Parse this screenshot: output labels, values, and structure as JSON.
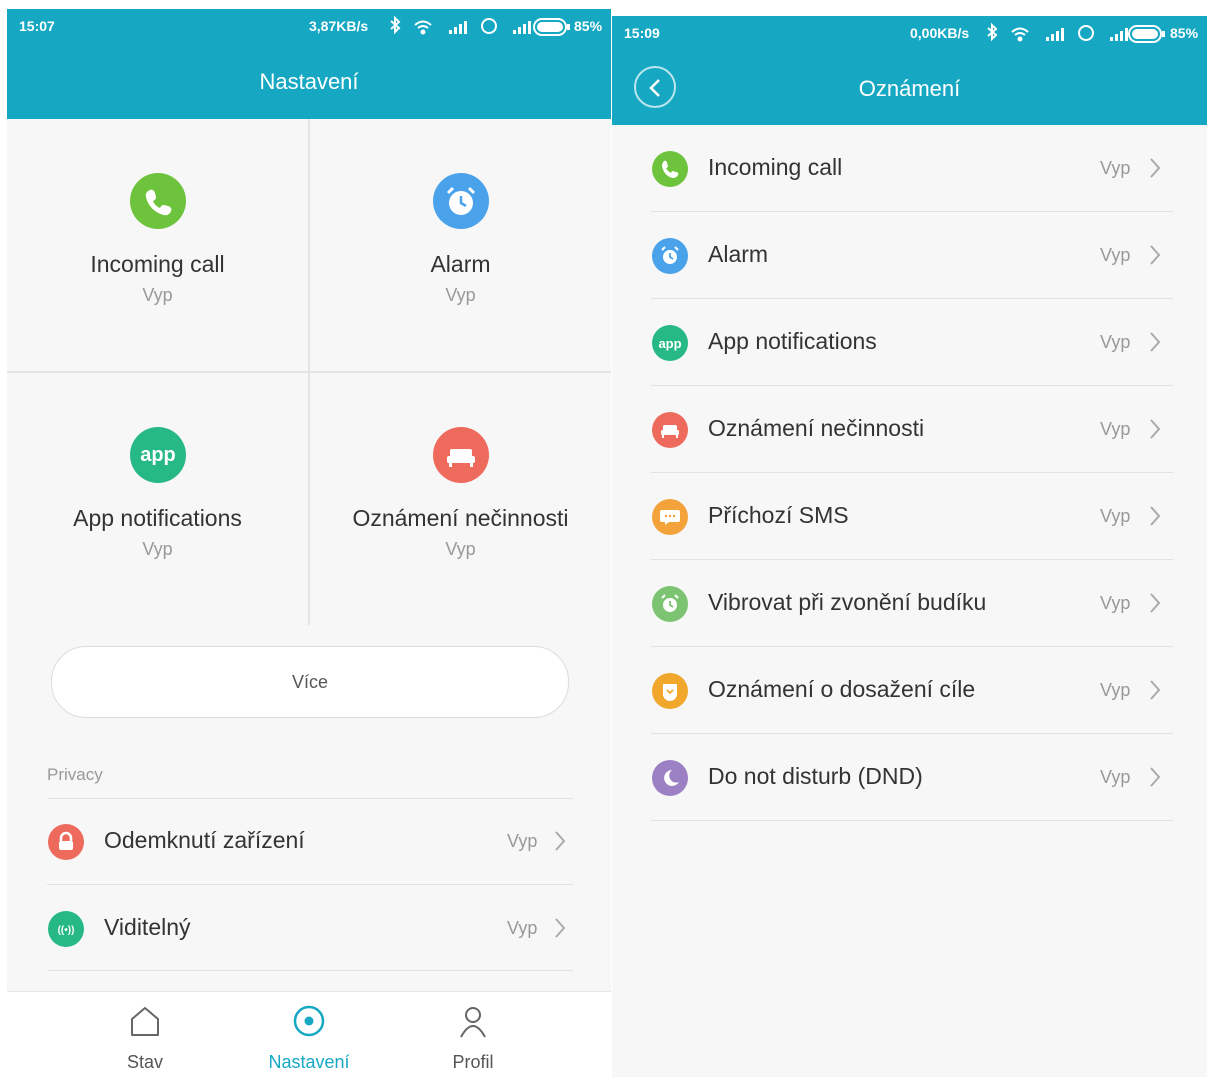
{
  "colors": {
    "accent": "#16a8c3",
    "green": "#6ec33c",
    "blue": "#4aa2ea",
    "teal": "#26b985",
    "red": "#ee6a5c",
    "orange": "#f4a23a",
    "lightgreen": "#7cc472",
    "amber": "#f1a62c",
    "purple": "#9b80c4"
  },
  "left": {
    "status": {
      "time": "15:07",
      "speed": "3,87KB/s",
      "battery": "85%"
    },
    "title": "Nastavení",
    "tiles": [
      {
        "label": "Incoming call",
        "value": "Vyp",
        "icon": "phone-icon"
      },
      {
        "label": "Alarm",
        "value": "Vyp",
        "icon": "alarm-clock-icon"
      },
      {
        "label": "App notifications",
        "value": "Vyp",
        "icon": "app-icon",
        "icon_text": "app"
      },
      {
        "label": "Oznámení nečinnosti",
        "value": "Vyp",
        "icon": "sofa-icon"
      }
    ],
    "more_button": "Více",
    "privacy_label": "Privacy",
    "privacy_rows": [
      {
        "label": "Odemknutí zařízení",
        "value": "Vyp",
        "icon": "lock-icon"
      },
      {
        "label": "Viditelný",
        "value": "Vyp",
        "icon": "broadcast-icon",
        "icon_text": "((•))"
      }
    ],
    "tabs": [
      {
        "label": "Stav",
        "icon": "home-icon"
      },
      {
        "label": "Nastavení",
        "icon": "settings-circle-icon",
        "active": true
      },
      {
        "label": "Profil",
        "icon": "person-icon"
      }
    ]
  },
  "right": {
    "status": {
      "time": "15:09",
      "speed": "0,00KB/s",
      "battery": "85%"
    },
    "title": "Oznámení",
    "rows": [
      {
        "label": "Incoming call",
        "value": "Vyp",
        "icon": "phone-icon"
      },
      {
        "label": "Alarm",
        "value": "Vyp",
        "icon": "alarm-clock-icon"
      },
      {
        "label": "App notifications",
        "value": "Vyp",
        "icon": "app-icon",
        "icon_text": "app"
      },
      {
        "label": "Oznámení nečinnosti",
        "value": "Vyp",
        "icon": "sofa-icon"
      },
      {
        "label": "Příchozí SMS",
        "value": "Vyp",
        "icon": "sms-icon"
      },
      {
        "label": "Vibrovat při zvonění budíku",
        "value": "Vyp",
        "icon": "alarm-vibrate-icon"
      },
      {
        "label": "Oznámení o dosažení cíle",
        "value": "Vyp",
        "icon": "goal-icon"
      },
      {
        "label": "Do not disturb (DND)",
        "value": "Vyp",
        "icon": "moon-icon"
      }
    ]
  }
}
